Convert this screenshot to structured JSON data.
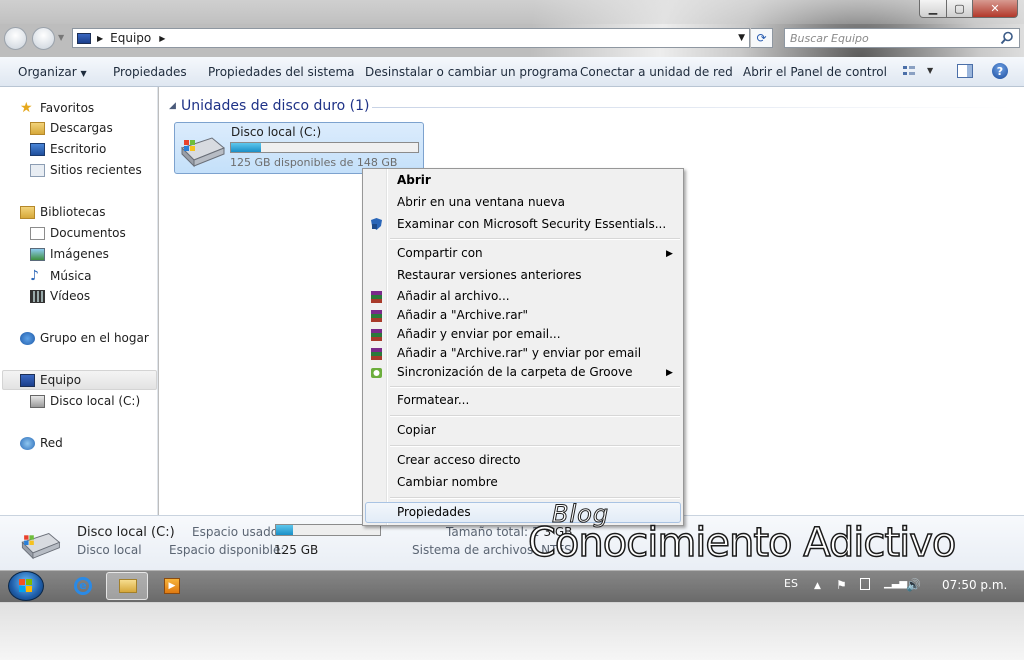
{
  "window": {
    "address": {
      "segment": "Equipo"
    },
    "search": {
      "placeholder": "Buscar Equipo"
    }
  },
  "toolbar": {
    "organize": "Organizar",
    "properties": "Propiedades",
    "system_properties": "Propiedades del sistema",
    "uninstall": "Desinstalar o cambiar un programa",
    "map_drive": "Conectar a unidad de red",
    "control_panel": "Abrir el Panel de control"
  },
  "navpane": {
    "favorites": "Favoritos",
    "downloads": "Descargas",
    "desktop": "Escritorio",
    "recent": "Sitios recientes",
    "libraries": "Bibliotecas",
    "documents": "Documentos",
    "images": "Imágenes",
    "music": "Música",
    "videos": "Vídeos",
    "homegroup": "Grupo en el hogar",
    "computer": "Equipo",
    "local_disk": "Disco local (C:)",
    "network": "Red"
  },
  "content": {
    "group_title": "Unidades de disco duro (1)",
    "drive": {
      "name": "Disco local (C:)",
      "free_text": "125 GB disponibles de 148 GB",
      "used_fraction": 0.16
    }
  },
  "context_menu": {
    "open": "Abrir",
    "open_new_window": "Abrir en una ventana nueva",
    "scan_mse": "Examinar con Microsoft Security Essentials...",
    "share_with": "Compartir con",
    "restore_versions": "Restaurar versiones anteriores",
    "add_archive": "Añadir al archivo...",
    "add_archive_rar": "Añadir a \"Archive.rar\"",
    "add_email": "Añadir y enviar por email...",
    "add_rar_email": "Añadir a \"Archive.rar\" y enviar por email",
    "groove_sync": "Sincronización de la carpeta de Groove",
    "format": "Formatear...",
    "copy": "Copiar",
    "create_shortcut": "Crear acceso directo",
    "rename": "Cambiar nombre",
    "properties": "Propiedades"
  },
  "details": {
    "name": "Disco local (C:)",
    "type": "Disco local",
    "space_used_label": "Espacio usado:",
    "space_free_label": "Espacio disponible:",
    "space_free_value": "125 GB",
    "total_size": "Tamaño total: 1",
    "total_size_value": "3 GB",
    "filesystem": "Sistema de archivos: NTFS",
    "used_fraction": 0.16
  },
  "watermark": {
    "blog": "Blog",
    "brand": "Conocimiento Adictivo"
  },
  "taskbar": {
    "language": "ES",
    "clock": "07:50 p.m."
  },
  "colors": {
    "accent": "#1e3287",
    "selection": "#c4e0fa",
    "bar": "#1a8fc7"
  }
}
